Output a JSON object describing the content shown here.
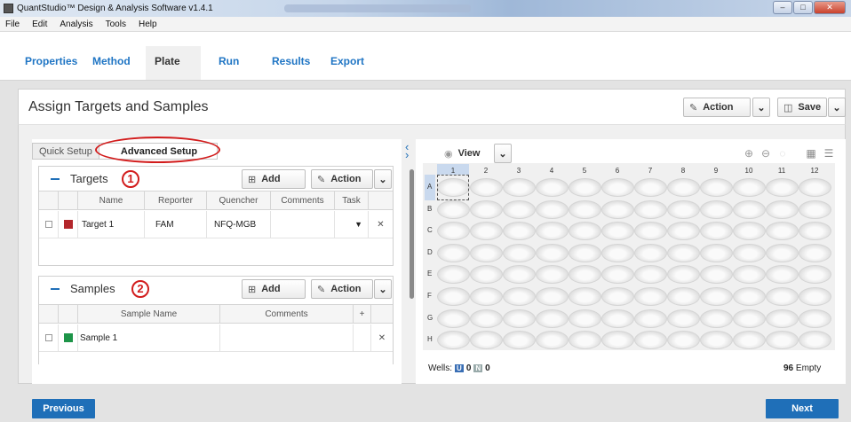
{
  "window": {
    "title": "QuantStudio™ Design & Analysis Software v1.4.1"
  },
  "menu": [
    "File",
    "Edit",
    "Analysis",
    "Tools",
    "Help"
  ],
  "nav": {
    "tabs": [
      "Properties",
      "Method",
      "Plate",
      "Run",
      "Results",
      "Export"
    ],
    "active": "Plate"
  },
  "page": {
    "title": "Assign Targets and Samples",
    "action_label": "Action",
    "save_label": "Save"
  },
  "setup_tabs": [
    "Quick Setup",
    "Advanced Setup"
  ],
  "targets": {
    "title": "Targets",
    "marker": "1",
    "add_label": "Add",
    "action_label": "Action",
    "columns": [
      "Name",
      "Reporter",
      "Quencher",
      "Comments",
      "Task"
    ],
    "rows": [
      {
        "name": "Target 1",
        "reporter": "FAM",
        "quencher": "NFQ-MGB",
        "comments": "",
        "color": "#b3262b"
      }
    ]
  },
  "samples": {
    "title": "Samples",
    "marker": "2",
    "add_label": "Add",
    "action_label": "Action",
    "columns": [
      "Sample Name",
      "Comments",
      "+"
    ],
    "rows": [
      {
        "name": "Sample 1",
        "comments": "",
        "color": "#1d9448"
      }
    ]
  },
  "plate": {
    "view_label": "View",
    "columns": [
      "1",
      "2",
      "3",
      "4",
      "5",
      "6",
      "7",
      "8",
      "9",
      "10",
      "11",
      "12"
    ],
    "rows": [
      "A",
      "B",
      "C",
      "D",
      "E",
      "F",
      "G",
      "H"
    ],
    "wells_label": "Wells:",
    "u_count": "0",
    "n_count": "0",
    "empty_count": "96",
    "empty_label": "Empty",
    "u_letter": "U",
    "n_letter": "N"
  },
  "footer": {
    "previous": "Previous",
    "next": "Next"
  }
}
